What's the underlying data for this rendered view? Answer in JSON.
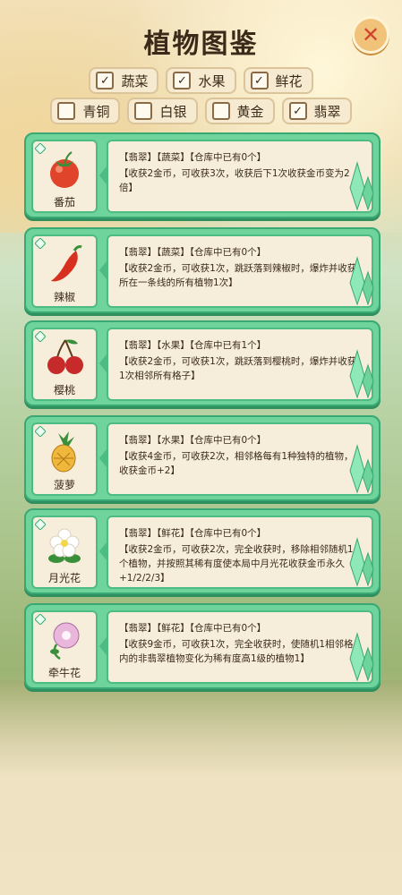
{
  "title": "植物图鉴",
  "close_label": "✕",
  "filters_row1": [
    {
      "label": "蔬菜",
      "checked": true
    },
    {
      "label": "水果",
      "checked": true
    },
    {
      "label": "鲜花",
      "checked": true
    }
  ],
  "filters_row2": [
    {
      "label": "青铜",
      "checked": false
    },
    {
      "label": "白银",
      "checked": false
    },
    {
      "label": "黄金",
      "checked": false
    },
    {
      "label": "翡翠",
      "checked": true
    }
  ],
  "plants": [
    {
      "name": "番茄",
      "icon": "tomato-icon",
      "rarity": "【翡翠】",
      "category": "【蔬菜】",
      "stock": "【仓库中已有0个】",
      "desc": "【收获2金币，可收获3次，收获后下1次收获金币变为2倍】"
    },
    {
      "name": "辣椒",
      "icon": "chili-icon",
      "rarity": "【翡翠】",
      "category": "【蔬菜】",
      "stock": "【仓库中已有0个】",
      "desc": "【收获2金币，可收获1次，跳跃落到辣椒时，爆炸并收获所在一条线的所有植物1次】"
    },
    {
      "name": "樱桃",
      "icon": "cherry-icon",
      "rarity": "【翡翠】",
      "category": "【水果】",
      "stock": "【仓库中已有1个】",
      "desc": "【收获2金币，可收获1次，跳跃落到樱桃时，爆炸并收获1次相邻所有格子】"
    },
    {
      "name": "菠萝",
      "icon": "pineapple-icon",
      "rarity": "【翡翠】",
      "category": "【水果】",
      "stock": "【仓库中已有0个】",
      "desc": "【收获4金币，可收获2次，相邻格每有1种独特的植物，收获金币+2】"
    },
    {
      "name": "月光花",
      "icon": "moonflower-icon",
      "rarity": "【翡翠】",
      "category": "【鲜花】",
      "stock": "【仓库中已有0个】",
      "desc": "【收获2金币，可收获2次，完全收获时，移除相邻随机1个植物，并按照其稀有度使本局中月光花收获金币永久+1/2/2/3】"
    },
    {
      "name": "牵牛花",
      "icon": "morning-glory-icon",
      "rarity": "【翡翠】",
      "category": "【鲜花】",
      "stock": "【仓库中已有0个】",
      "desc": "【收获9金币，可收获1次，完全收获时，使随机1相邻格内的非翡翠植物变化为稀有度高1级的植物1】"
    }
  ]
}
